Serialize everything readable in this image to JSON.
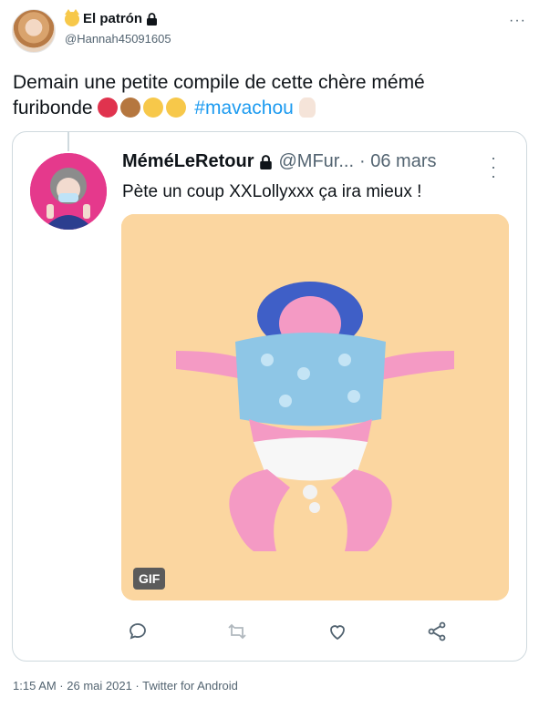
{
  "author": {
    "display_name": "El patrón",
    "handle": "@Hannah45091605",
    "verified_lock": true
  },
  "tweet": {
    "text_line1": "Demain une petite compile de cette chère mémé",
    "text_line2": "furibonde",
    "hashtag": "#mavachou",
    "emojis": [
      "angry-face",
      "see-no-evil-monkey",
      "grinning-cat",
      "grinning-cat",
      "victory-hand"
    ]
  },
  "quoted": {
    "display_name": "MéméLeRetour",
    "handle": "@MFur...",
    "date": "· 06 mars",
    "text": "Pète un coup XXLollyxxx ça ira mieux !",
    "media_badge": "GIF"
  },
  "actions": [
    "reply-icon",
    "retweet-icon",
    "like-icon",
    "share-icon"
  ],
  "footer": {
    "meta": "1:15 AM · 26 mai 2021 · Twitter for Android"
  },
  "colors": {
    "accent": "#1d9bf0",
    "secondary_text": "#536471",
    "border": "#cfd9de",
    "gif_background": "#fbd6a0"
  }
}
